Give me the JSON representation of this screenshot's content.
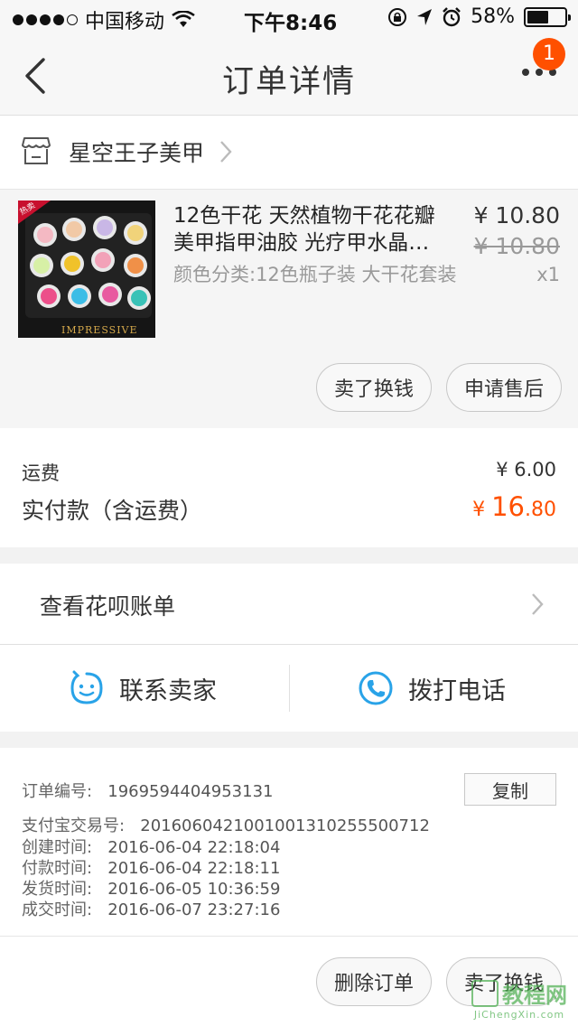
{
  "status_bar": {
    "carrier": "中国移动",
    "time": "下午8:46",
    "battery_text": "58%",
    "battery_level": 0.58,
    "icons": [
      "signal-dots",
      "wifi-icon",
      "rotation-lock-icon",
      "location-arrow-icon",
      "alarm-icon",
      "battery-icon"
    ]
  },
  "nav": {
    "title": "订单详情",
    "badge_count": "1",
    "icons": [
      "back-chevron-icon",
      "more-dots-icon"
    ]
  },
  "shop": {
    "name": "星空王子美甲",
    "icons": [
      "shop-icon",
      "chevron-right-icon"
    ]
  },
  "product": {
    "title": "12色干花 天然植物干花花瓣美甲指甲油胶 光疗甲水晶…",
    "sku": "颜色分类:12色瓶子装 大干花套装",
    "price_now": "¥ 10.80",
    "price_old": "¥ 10.80",
    "quantity": "x1",
    "image_text": "IMPRESSIVE",
    "image_tag": "热卖",
    "actions": [
      "卖了换钱",
      "申请售后"
    ]
  },
  "fees": {
    "shipping_label": "运费",
    "shipping_value": "¥ 6.00",
    "paid_label": "实付款（含运费）",
    "paid_currency": "¥ ",
    "paid_int": "16",
    "paid_dec": ".80"
  },
  "huabei": {
    "label": "查看花呗账单"
  },
  "contact": {
    "seller_label": "联系卖家",
    "phone_label": "拨打电话",
    "icons": [
      "chat-face-icon",
      "phone-icon"
    ]
  },
  "order_info": {
    "copy_label": "复制",
    "lines": [
      {
        "label": "订单编号:",
        "value": "1969594404953131"
      },
      {
        "label": "支付宝交易号:",
        "value": "2016060421001001310255500712"
      },
      {
        "label": "创建时间:",
        "value": "2016-06-04 22:18:04"
      },
      {
        "label": "付款时间:",
        "value": "2016-06-04 22:18:11"
      },
      {
        "label": "发货时间:",
        "value": "2016-06-05 10:36:59"
      },
      {
        "label": "成交时间:",
        "value": "2016-06-07 23:27:16"
      }
    ],
    "bottom_actions": [
      "删除订单",
      "卖了换钱"
    ]
  },
  "watermark": {
    "text": "教程网",
    "url": "JiChengXin.com"
  },
  "colors": {
    "accent_orange": "#ff5000",
    "icon_blue": "#29a3e8"
  }
}
